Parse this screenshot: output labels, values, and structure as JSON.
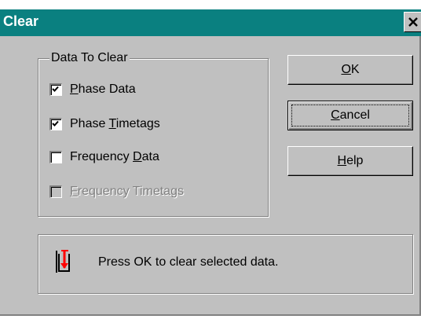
{
  "window": {
    "title": "Clear",
    "close_icon": "close-icon"
  },
  "group": {
    "title": "Data To Clear",
    "items": [
      {
        "pre": "",
        "accel": "P",
        "post": "hase Data",
        "checked": true,
        "enabled": true
      },
      {
        "pre": "Phase ",
        "accel": "T",
        "post": "imetags",
        "checked": true,
        "enabled": true
      },
      {
        "pre": "Frequency ",
        "accel": "D",
        "post": "ata",
        "checked": false,
        "enabled": true
      },
      {
        "pre": "",
        "accel": "F",
        "post": "requency Timetags",
        "checked": false,
        "enabled": false
      }
    ]
  },
  "buttons": {
    "ok": {
      "pre": "",
      "accel": "O",
      "post": "K"
    },
    "cancel": {
      "pre": "",
      "accel": "C",
      "post": "ancel"
    },
    "help": {
      "pre": "",
      "accel": "H",
      "post": "elp"
    }
  },
  "info": {
    "icon": "clear-data-icon",
    "message": "Press OK to clear selected data."
  },
  "colors": {
    "title_bar": "#0a8080",
    "face": "#c0c0c0",
    "icon_red": "#ff0000"
  }
}
